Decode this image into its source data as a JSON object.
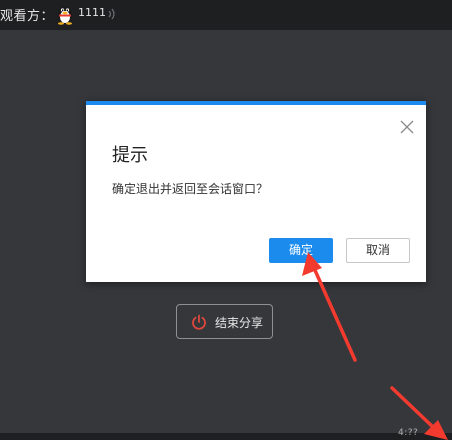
{
  "viewer_bar": {
    "label": "观看方：",
    "avatar_icon": "qq-penguin-icon",
    "name": "1111",
    "signal_icon": "signal-icon"
  },
  "dialog": {
    "title": "提示",
    "message": "确定退出并返回至会话窗口？",
    "confirm_label": "确定",
    "cancel_label": "取消",
    "close_icon": "close-icon",
    "accent_color": "#1b8cee"
  },
  "end_share": {
    "label": "结束分享",
    "icon": "power-icon",
    "icon_color": "#e0473c"
  },
  "corner": {
    "text": "4:??"
  },
  "annotations": {
    "arrow_color": "#f23a2f"
  }
}
